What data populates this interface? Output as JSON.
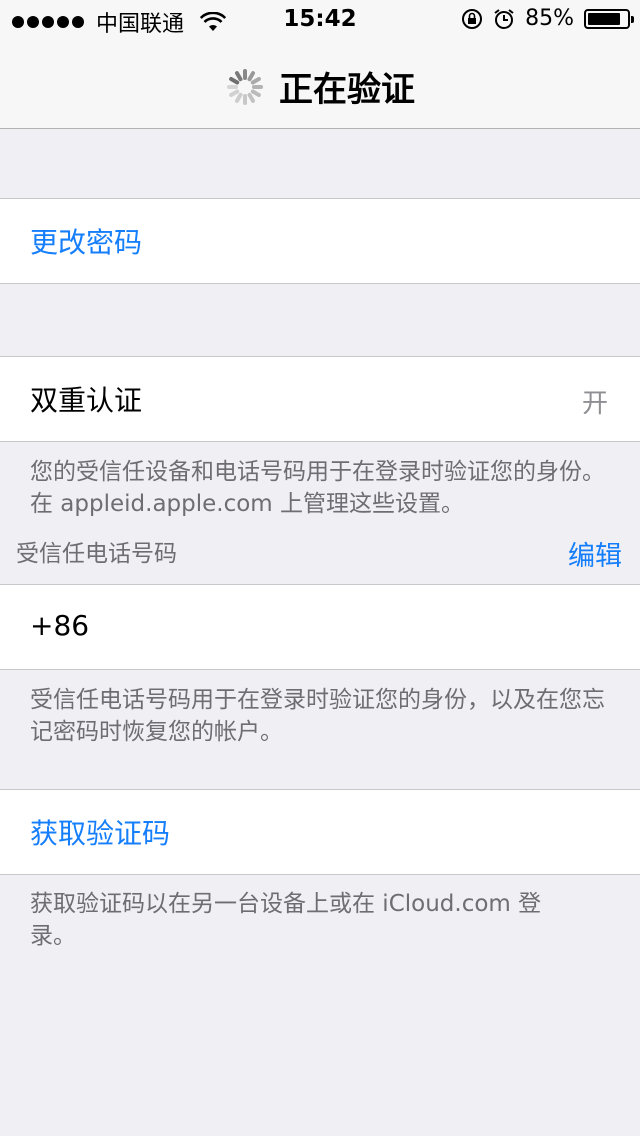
{
  "status_bar": {
    "carrier": "中国联通",
    "time": "15:42",
    "battery": "85%",
    "battery_level": 0.85,
    "icons": [
      "signal-dots-icon",
      "wifi-icon",
      "rotation-lock-icon",
      "alarm-icon",
      "battery-icon"
    ]
  },
  "nav": {
    "title": "正在验证",
    "spinner_icon": "activity-spinner-icon"
  },
  "change_password": {
    "label": "更改密码"
  },
  "two_factor": {
    "label": "双重认证",
    "value": "开",
    "footer": "您的受信任设备和电话号码用于在登录时验证您的身份。在 appleid.apple.com 上管理这些设置。"
  },
  "trusted_phone": {
    "header": "受信任电话号码",
    "edit": "编辑",
    "number": "+86",
    "footer": "受信任电话号码用于在登录时验证您的身份，以及在您忘记密码时恢复您的帐户。"
  },
  "get_code": {
    "label": "获取验证码",
    "footer": "获取验证码以在另一台设备上或在 iCloud.com 登录。"
  },
  "colors": {
    "accent": "#157efb",
    "background": "#efeff4",
    "secondary_text": "#6d6d72"
  }
}
